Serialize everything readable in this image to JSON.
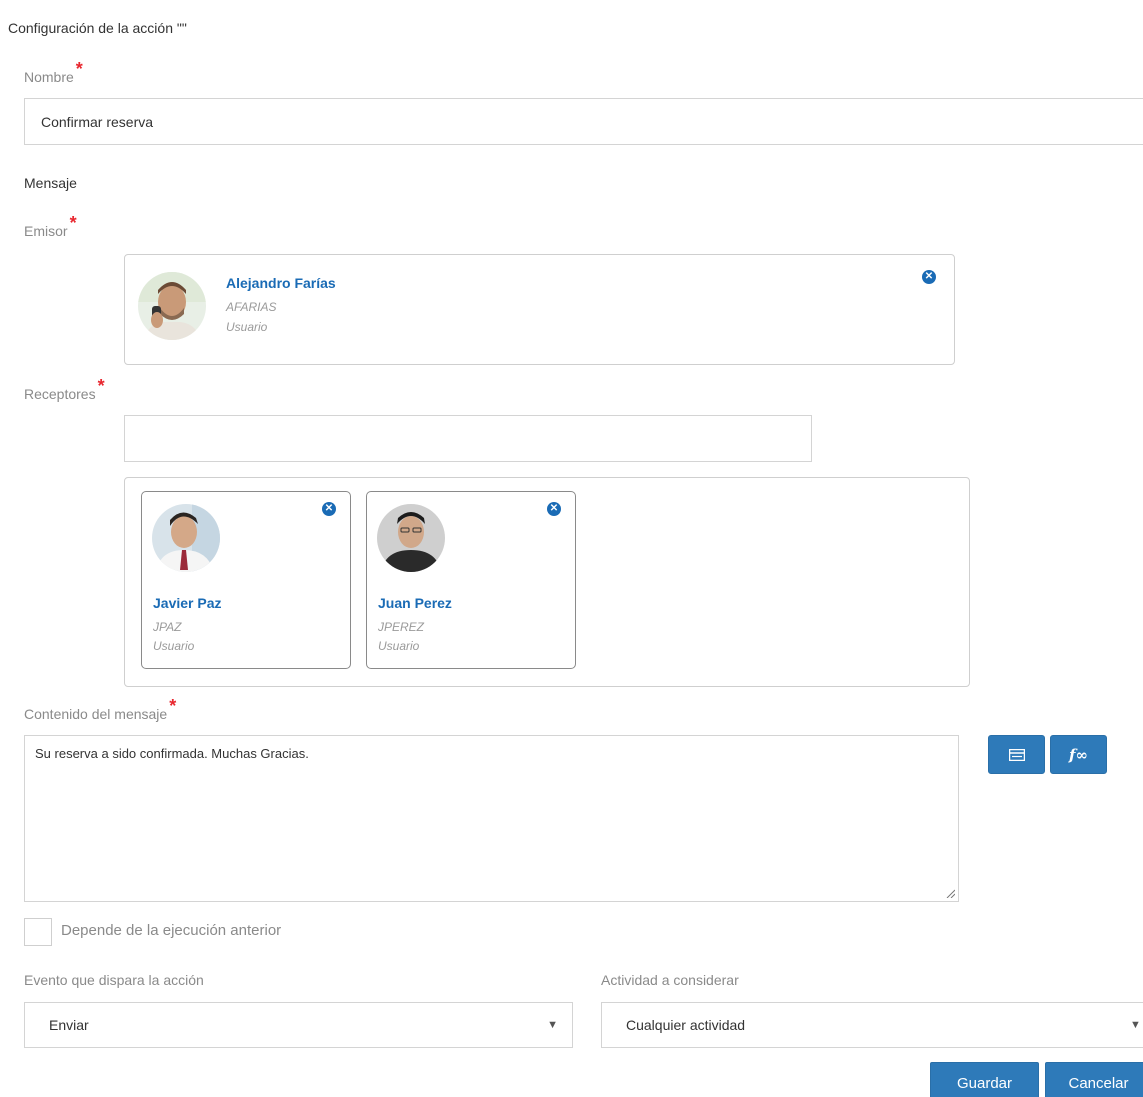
{
  "dialog": {
    "title": "Configuración de la acción \"\""
  },
  "name_field": {
    "label": "Nombre",
    "required_mark": "*",
    "value": "Confirmar reserva"
  },
  "message_section": {
    "label": "Mensaje"
  },
  "sender": {
    "label": "Emisor",
    "required_mark": "*",
    "user": {
      "name": "Alejandro Farías",
      "username": "AFARIAS",
      "type": "Usuario",
      "remove_icon": "close-circle-icon"
    }
  },
  "recipients": {
    "label": "Receptores",
    "required_mark": "*",
    "search_value": "",
    "users": [
      {
        "name": "Javier Paz",
        "username": "JPAZ",
        "type": "Usuario",
        "remove_icon": "close-circle-icon"
      },
      {
        "name": "Juan Perez",
        "username": "JPEREZ",
        "type": "Usuario",
        "remove_icon": "close-circle-icon"
      }
    ]
  },
  "content": {
    "label": "Contenido del mensaje",
    "required_mark": "*",
    "value": "Su reserva a sido confirmada. Muchas Gracias.",
    "tools": [
      {
        "icon": "form-field-icon"
      },
      {
        "icon": "function-icon",
        "glyph": "f∞"
      }
    ]
  },
  "depends_checkbox": {
    "label": "Depende de la ejecución anterior",
    "checked": false
  },
  "trigger_event": {
    "label": "Evento que dispara la acción",
    "selected": "Enviar"
  },
  "activity": {
    "label": "Actividad a considerar",
    "selected": "Cualquier actividad"
  },
  "footer": {
    "save_label": "Guardar",
    "cancel_label": "Cancelar"
  },
  "colors": {
    "accent": "#2e7ab9",
    "link": "#1a6bb5",
    "required": "#e8262e"
  }
}
